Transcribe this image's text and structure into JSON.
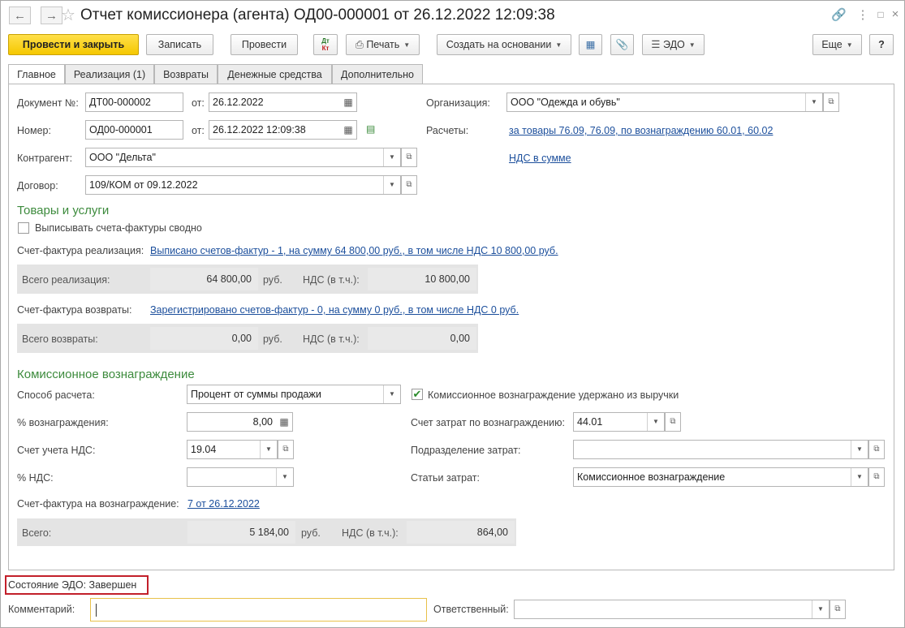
{
  "window": {
    "title": "Отчет комиссионера (агента) ОД00-000001 от 26.12.2022 12:09:38",
    "icons": {
      "back": "arrow-left-icon",
      "forward": "arrow-right-icon",
      "favorite": "star-icon",
      "link": "link-icon",
      "more": "more-vertical-icon",
      "maximize": "maximize-icon",
      "close": "close-icon"
    }
  },
  "toolbar": {
    "post_close": "Провести и закрыть",
    "save": "Записать",
    "post": "Провести",
    "dt_kt_top": "Дт",
    "dt_kt_bottom": "Кт",
    "print": "Печать",
    "create_based": "Создать на основании",
    "edo": "ЭДО",
    "more": "Еще",
    "help": "?"
  },
  "tabs": [
    {
      "label": "Главное",
      "active": true
    },
    {
      "label": "Реализация (1)",
      "active": false
    },
    {
      "label": "Возвраты",
      "active": false
    },
    {
      "label": "Денежные средства",
      "active": false
    },
    {
      "label": "Дополнительно",
      "active": false
    }
  ],
  "main": {
    "doc_no_label": "Документ №:",
    "doc_no_value": "ДТ00-000002",
    "from_label": "от:",
    "doc_date": "26.12.2022",
    "number_label": "Номер:",
    "number_value": "ОД00-000001",
    "number_date": "26.12.2022 12:09:38",
    "org_label": "Организация:",
    "org_value": "ООО \"Одежда и обувь\"",
    "settlements_label": "Расчеты:",
    "settlements_link": "за товары 76.09, 76.09, по вознаграждению 60.01, 60.02",
    "vat_link": "НДС в сумме",
    "counterparty_label": "Контрагент:",
    "counterparty_value": "ООО \"Дельта\"",
    "contract_label": "Договор:",
    "contract_value": "109/КОМ от 09.12.2022"
  },
  "goods": {
    "section_title": "Товары и услуги",
    "checkbox_label": "Выписывать счета-фактуры сводно",
    "checkbox_checked": false,
    "invoice_sales_label": "Счет-фактура реализация:",
    "invoice_sales_link": "Выписано счетов-фактур - 1, на сумму 64 800,00 руб., в том числе НДС 10 800,00 руб.",
    "total_sales_label": "Всего реализация:",
    "total_sales_value": "64 800,00",
    "currency": "руб.",
    "vat_incl_label": "НДС (в т.ч.):",
    "sales_vat_value": "10 800,00",
    "invoice_returns_label": "Счет-фактура возвраты:",
    "invoice_returns_link": "Зарегистрировано счетов-фактур - 0, на сумму 0 руб., в том числе НДС 0 руб.",
    "total_returns_label": "Всего возвраты:",
    "total_returns_value": "0,00",
    "returns_vat_value": "0,00"
  },
  "commission": {
    "section_title": "Комиссионное вознаграждение",
    "calc_method_label": "Способ расчета:",
    "calc_method_value": "Процент от суммы продажи",
    "withheld_label": "Комиссионное вознаграждение удержано из выручки",
    "withheld_checked": true,
    "percent_label": "% вознаграждения:",
    "percent_value": "8,00",
    "cost_account_label": "Счет затрат по вознаграждению:",
    "cost_account_value": "44.01",
    "vat_account_label": "Счет учета НДС:",
    "vat_account_value": "19.04",
    "cost_division_label": "Подразделение затрат:",
    "cost_division_value": "",
    "vat_rate_label": "% НДС:",
    "vat_rate_value": "",
    "cost_items_label": "Статьи затрат:",
    "cost_items_value": "Комиссионное вознаграждение",
    "invoice_label": "Счет-фактура на вознаграждение:",
    "invoice_link": "7 от 26.12.2022",
    "total_label": "Всего:",
    "total_value": "5 184,00",
    "currency": "руб.",
    "vat_incl_label": "НДС (в т.ч.):",
    "total_vat_value": "864,00"
  },
  "footer": {
    "edo_status": "Состояние ЭДО: Завершен",
    "comment_label": "Комментарий:",
    "comment_value": "",
    "responsible_label": "Ответственный:",
    "responsible_value": ""
  },
  "colors": {
    "accent": "#f5c800",
    "link": "#1c4f9c",
    "section": "#3d8b3d",
    "highlight": "#c21f2a"
  }
}
